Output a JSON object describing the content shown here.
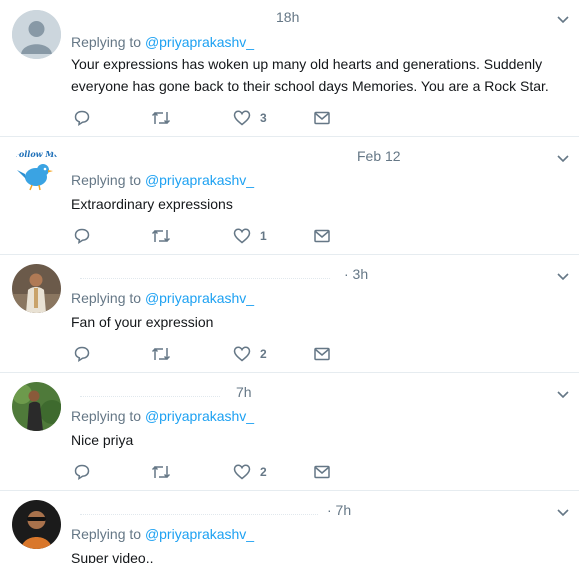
{
  "tweets": [
    {
      "time": "18h",
      "reply_prefix": "Replying to",
      "handle": "@priyaprakashv_",
      "text": "Your expressions has woken up many old hearts and generations. Suddenly everyone has gone back to their school days Memories. You are a Rock Star.",
      "likes": "3",
      "avatar": "default-avatar"
    },
    {
      "time": "Feb 12",
      "reply_prefix": "Replying to",
      "handle": "@priyaprakashv_",
      "text": "Extraordinary expressions",
      "likes": "1",
      "avatar": "follow-me-bird-avatar",
      "avatar_text": "Follow Me"
    },
    {
      "time": "· 3h",
      "reply_prefix": "Replying to",
      "handle": "@priyaprakashv_",
      "text": "Fan of your expression",
      "likes": "2",
      "avatar": "user-photo-avatar"
    },
    {
      "time": "7h",
      "reply_prefix": "Replying to",
      "handle": "@priyaprakashv_",
      "text": "Nice priya",
      "likes": "2",
      "avatar": "user-photo-avatar"
    },
    {
      "time": "· 7h",
      "reply_prefix": "Replying to",
      "handle": "@priyaprakashv_",
      "text": "Super video..",
      "avatar": "user-photo-avatar"
    }
  ],
  "colors": {
    "link": "#1da1f2",
    "muted": "#657786",
    "text": "#14171a",
    "divider": "#e6ecf0"
  },
  "icons": [
    "reply-icon",
    "retweet-icon",
    "heart-icon",
    "direct-message-icon",
    "chevron-down-icon"
  ]
}
